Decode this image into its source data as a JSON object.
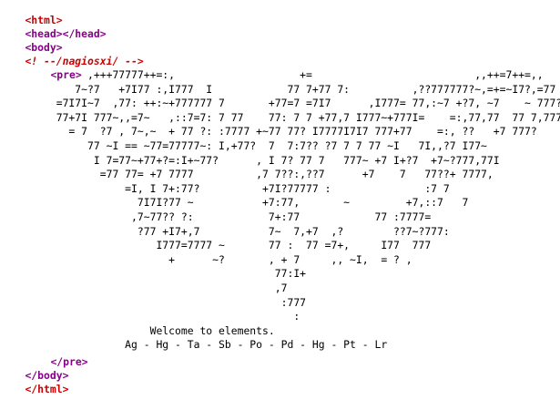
{
  "source": {
    "html_open": "<html>",
    "head_open": "<head>",
    "head_close": "</head>",
    "body_open": "<body>",
    "comment": "<! --/nagiosxi/ -->",
    "pre_open": "<pre>",
    "ascii_art": "              ,+++77777++=:,                    +=                          ,,++=7++=,,\n            7~?7   +7I77 :,I777  I            77 7+77 7:          ,??777777?~,=+=~I7?,=77 I\n         =7I7I~7  ,77: ++:~+777777 7       +77=7 =7I7      ,I777= 77,:~7 +?7, ~7    ~ 777?\n         77+7I 777~,,=7~   ,::7=7: 7 77    77: 7 7 +77,7 I777~+777I=    =:,77,77  77 7,777,\n           = 7  ?7 , 7~,~  + 77 ?: :7777 +~77 77? I7777I7I7 777+77    =:, ??   +7 777?\n              77 ~I == ~77=77777~: I,+77?  7  7:7?? ?7 7 7 77 ~I   7I,,?7 I77~\n               I 7=77~+77+?=:I+~77?      , I 7? 77 7   777~ +7 I+?7  +7~?777,77I\n                =77 77= +7 7777          ,7 7??:,??7      +7    7   77??+ 7777,\n                    =I, I 7+:77?          +7I?77777 :               :7 7\n                      7I7I?77 ~           +7:77,       ~         +7,::7   7\n                     ,7~77?? ?:            7+:77            77 :7777=\n                      ?77 +I7+,7           7~  7,+7  ,?        ??7~?777:\n                         I777=7777 ~       77 :  77 =7+,     I77  777\n                           +      ~?       , + 7     ,, ~I,  = ? ,\n                                            77:I+\n                                            ,7\n                                             :777\n                                               :\n                        Welcome to elements.\n                    Ag - Hg - Ta - Sb - Po - Pd - Hg - Pt - Lr",
    "pre_close": "</pre>",
    "body_close": "</body>",
    "html_close": "</html>"
  }
}
